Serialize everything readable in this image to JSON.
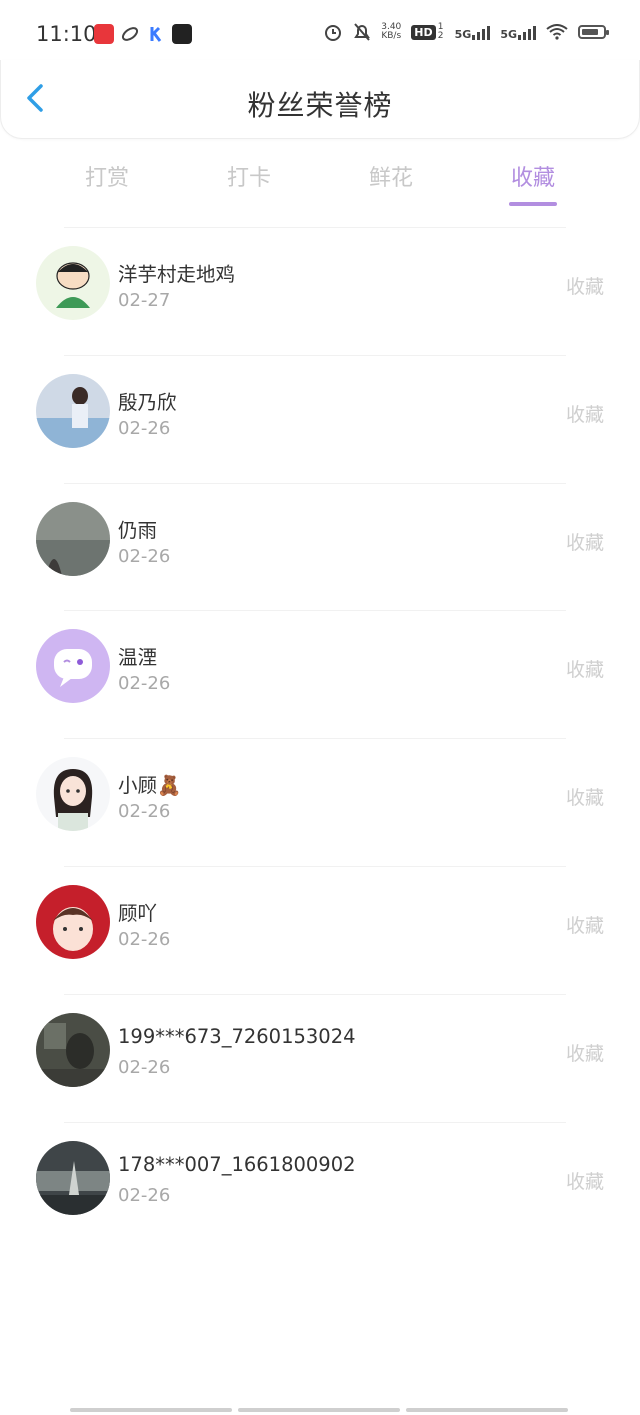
{
  "status_bar": {
    "time": "11:10",
    "net_speed_value": "3.40",
    "net_speed_unit": "KB/s",
    "hd": "HD",
    "hd_sub": "1 2",
    "net1": "5G",
    "net2": "5G"
  },
  "header": {
    "title": "粉丝荣誉榜"
  },
  "tabs": [
    {
      "label": "打赏"
    },
    {
      "label": "打卡"
    },
    {
      "label": "鲜花"
    },
    {
      "label": "收藏"
    }
  ],
  "active_tab": "收藏",
  "accent_color": "#b28ee0",
  "back_color": "#2f9ee6",
  "entries": [
    {
      "name": "洋芋村走地鸡",
      "date": "02-27",
      "action": "收藏"
    },
    {
      "name": "殷乃欣",
      "date": "02-26",
      "action": "收藏"
    },
    {
      "name": "仍雨",
      "date": "02-26",
      "action": "收藏"
    },
    {
      "name": "温湮",
      "date": "02-26",
      "action": "收藏"
    },
    {
      "name": "小顾🧸",
      "date": "02-26",
      "action": "收藏"
    },
    {
      "name": "顾吖",
      "date": "02-26",
      "action": "收藏"
    },
    {
      "name": "199***673_7260153024",
      "date": "02-26",
      "action": "收藏"
    },
    {
      "name": "178***007_1661800902",
      "date": "02-26",
      "action": "收藏"
    }
  ]
}
